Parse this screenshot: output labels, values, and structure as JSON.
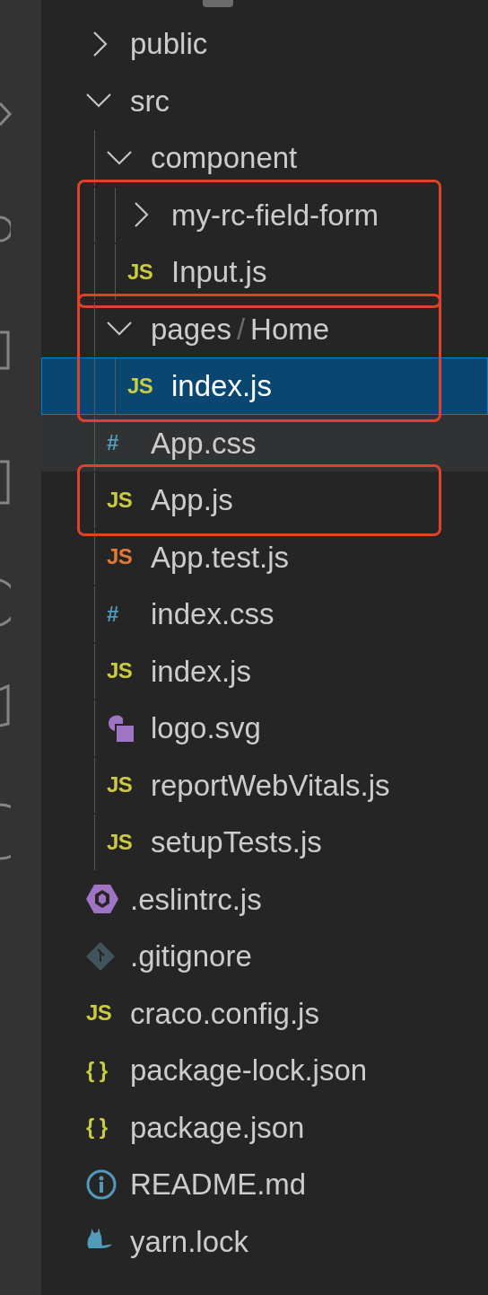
{
  "explorer": {
    "tree": [
      {
        "name": "public",
        "kind": "folder",
        "expanded": false,
        "selected": false,
        "hovered": false,
        "boxed": false
      },
      {
        "name": "src",
        "kind": "folder",
        "expanded": true,
        "selected": false,
        "hovered": false,
        "boxed": false,
        "children": [
          {
            "name": "component",
            "kind": "folder",
            "expanded": true,
            "selected": false,
            "hovered": false,
            "boxed": false,
            "children": [
              {
                "name": "my-rc-field-form",
                "kind": "folder",
                "expanded": false,
                "selected": false,
                "hovered": false,
                "boxed": true
              },
              {
                "name": "Input.js",
                "kind": "glyph",
                "icon_text": "JS",
                "color": "#cbcb41",
                "selected": false,
                "hovered": false,
                "boxed": true
              }
            ]
          },
          {
            "name": "pages",
            "compact_child": "Home",
            "separator": "/",
            "kind": "folder",
            "expanded": true,
            "selected": false,
            "hovered": false,
            "boxed": true,
            "box_start": true,
            "children": [
              {
                "name": "index.js",
                "kind": "glyph",
                "icon_text": "JS",
                "color": "#cbcb41",
                "selected": true,
                "hovered": false,
                "boxed": true
              }
            ]
          },
          {
            "name": "App.css",
            "kind": "glyph",
            "icon_text": "#",
            "color": "#519aba",
            "selected": false,
            "hovered": true,
            "boxed": false
          },
          {
            "name": "App.js",
            "kind": "glyph",
            "icon_text": "JS",
            "color": "#cbcb41",
            "selected": false,
            "hovered": false,
            "boxed": true
          },
          {
            "name": "App.test.js",
            "kind": "glyph",
            "icon_text": "JS",
            "color": "#e37933",
            "selected": false,
            "hovered": false,
            "boxed": false
          },
          {
            "name": "index.css",
            "kind": "glyph",
            "icon_text": "#",
            "color": "#519aba",
            "selected": false,
            "hovered": false,
            "boxed": false
          },
          {
            "name": "index.js",
            "kind": "glyph",
            "icon_text": "JS",
            "color": "#cbcb41",
            "selected": false,
            "hovered": false,
            "boxed": false
          },
          {
            "name": "logo.svg",
            "kind": "shapes",
            "color": "#a074c4",
            "selected": false,
            "hovered": false,
            "boxed": false
          },
          {
            "name": "reportWebVitals.js",
            "kind": "glyph",
            "icon_text": "JS",
            "color": "#cbcb41",
            "selected": false,
            "hovered": false,
            "boxed": false
          },
          {
            "name": "setupTests.js",
            "kind": "glyph",
            "icon_text": "JS",
            "color": "#cbcb41",
            "selected": false,
            "hovered": false,
            "boxed": false
          }
        ]
      },
      {
        "name": ".eslintrc.js",
        "kind": "hexagon",
        "color": "#a074c4",
        "selected": false,
        "hovered": false,
        "boxed": false
      },
      {
        "name": ".gitignore",
        "kind": "diamond",
        "color": "#41535b",
        "selected": false,
        "hovered": false,
        "boxed": false
      },
      {
        "name": "craco.config.js",
        "kind": "glyph",
        "icon_text": "JS",
        "color": "#cbcb41",
        "selected": false,
        "hovered": false,
        "boxed": false
      },
      {
        "name": "package-lock.json",
        "kind": "glyph",
        "icon_text": "{ }",
        "color": "#cbcb41",
        "selected": false,
        "hovered": false,
        "boxed": false
      },
      {
        "name": "package.json",
        "kind": "glyph",
        "icon_text": "{ }",
        "color": "#cbcb41",
        "selected": false,
        "hovered": false,
        "boxed": false
      },
      {
        "name": "README.md",
        "kind": "info",
        "color": "#519aba",
        "selected": false,
        "hovered": false,
        "boxed": false
      },
      {
        "name": "yarn.lock",
        "kind": "cat",
        "color": "#519aba",
        "selected": false,
        "hovered": false,
        "boxed": false
      }
    ]
  }
}
